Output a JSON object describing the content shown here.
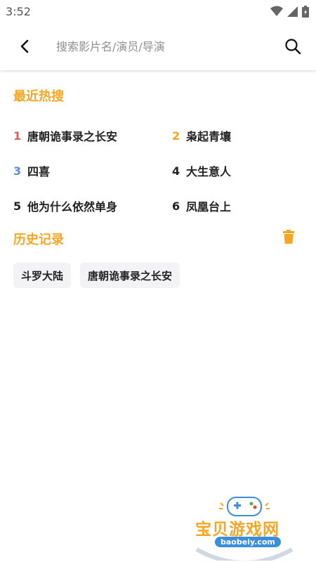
{
  "status_bar": {
    "time": "3:52",
    "icons": [
      "wifi-icon",
      "signal-icon",
      "battery-icon"
    ]
  },
  "search": {
    "placeholder": "搜索影片名/演员/导演",
    "back_icon": "chevron-left-icon",
    "search_icon": "search-icon"
  },
  "hot_search": {
    "title": "最近热搜",
    "items": [
      {
        "rank": "1",
        "label": "唐朝诡事录之长安",
        "rank_color": "#e05a5a"
      },
      {
        "rank": "2",
        "label": "枭起青壤",
        "rank_color": "#f5a623"
      },
      {
        "rank": "3",
        "label": "四喜",
        "rank_color": "#5b8fd6"
      },
      {
        "rank": "4",
        "label": "大生意人",
        "rank_color": "#222222"
      },
      {
        "rank": "5",
        "label": "他为什么依然单身",
        "rank_color": "#222222"
      },
      {
        "rank": "6",
        "label": "凤凰台上",
        "rank_color": "#222222"
      }
    ]
  },
  "history": {
    "title": "历史记录",
    "clear_icon": "trash-icon",
    "items": [
      "斗罗大陆",
      "唐朝诡事录之长安"
    ]
  },
  "watermark": {
    "title": "宝贝游戏网",
    "url": "baobeiy.com"
  },
  "colors": {
    "accent": "#f5a623",
    "chip_bg": "#f3f3f6"
  }
}
